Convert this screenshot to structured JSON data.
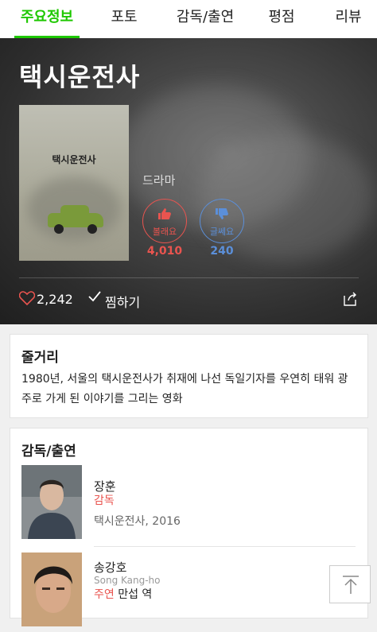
{
  "tabs": [
    {
      "label": "주요정보",
      "active": true
    },
    {
      "label": "포토"
    },
    {
      "label": "감독/출연"
    },
    {
      "label": "평점"
    },
    {
      "label": "리뷰"
    }
  ],
  "movie": {
    "title": "택시운전사",
    "poster_title": "택시운전사",
    "genre": "드라마",
    "like_label": "볼래요",
    "like_count": "4,010",
    "dislike_label": "글쎄요",
    "dislike_count": "240",
    "heart_count": "2,242",
    "wish_label": "찜하기"
  },
  "synopsis": {
    "heading": "줄거리",
    "text": "1980년, 서울의 택시운전사가 취재에 나선 독일기자를 우연히 태워 광주로 가게 된 이야기를 그리는 영화"
  },
  "cast": {
    "heading": "감독/출연",
    "people": [
      {
        "name": "장훈",
        "role": "감독",
        "meta": "택시운전사, 2016"
      },
      {
        "name": "송강호",
        "name_en": "Song Kang-ho",
        "role": "주연",
        "role_name": "만섭 역"
      }
    ]
  },
  "colors": {
    "accent": "#1ec800",
    "like": "#e9544f",
    "dislike": "#5b8fd9"
  },
  "icons": [
    "heart-icon",
    "check-icon",
    "share-icon",
    "thumbs-up-icon",
    "thumbs-down-icon",
    "arrow-up-icon"
  ]
}
